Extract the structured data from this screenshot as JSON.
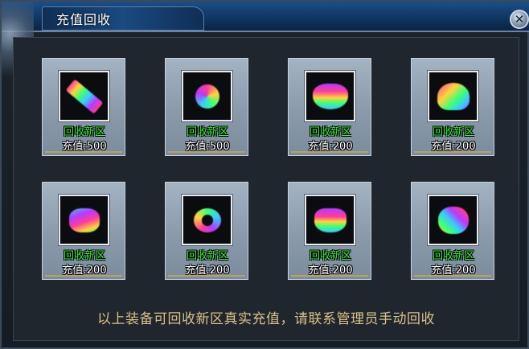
{
  "window": {
    "title": "充值回收",
    "close_icon": "close-icon"
  },
  "items": [
    {
      "recycle_label": "回收新区",
      "price_label": "充值:500",
      "icon": "rainbow-sword-icon"
    },
    {
      "recycle_label": "回收新区",
      "price_label": "充值:500",
      "icon": "rainbow-medal-icon"
    },
    {
      "recycle_label": "回收新区",
      "price_label": "充值:200",
      "icon": "rainbow-wings-icon"
    },
    {
      "recycle_label": "回收新区",
      "price_label": "充值:200",
      "icon": "rainbow-helmet-icon"
    },
    {
      "recycle_label": "回收新区",
      "price_label": "充值:200",
      "icon": "rainbow-armor-icon"
    },
    {
      "recycle_label": "回收新区",
      "price_label": "充值:200",
      "icon": "rainbow-necklace-icon"
    },
    {
      "recycle_label": "回收新区",
      "price_label": "充值:200",
      "icon": "rainbow-bracelet-icon"
    },
    {
      "recycle_label": "回收新区",
      "price_label": "充值:200",
      "icon": "rainbow-ring-icon"
    }
  ],
  "footer": {
    "notice": "以上装备可回收新区真实充值，请联系管理员手动回收"
  },
  "colors": {
    "recycle_text": "#38e83c",
    "price_text": "#ffffff",
    "footer_text": "#d9c08a",
    "title_bar": "#103763"
  }
}
